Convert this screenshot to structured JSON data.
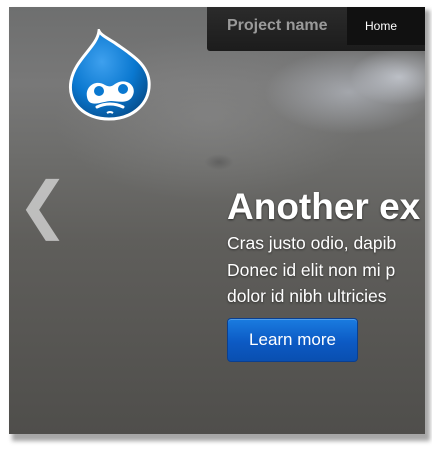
{
  "navbar": {
    "brand": "Project name",
    "items": [
      {
        "label": "Home",
        "active": true
      }
    ]
  },
  "carousel": {
    "prev_icon": "chevron-left-icon",
    "caption": {
      "title": "Another ex",
      "lines": [
        "Cras justo odio, dapib",
        "Donec id elit non mi p",
        "dolor id nibh ultricies"
      ],
      "button_label": "Learn more"
    }
  },
  "logo": {
    "icon": "drupal-drop-logo"
  },
  "colors": {
    "navbar_bg": "#222222",
    "nav_active_bg": "#111111",
    "button_blue": "#0c5ac4",
    "logo_blue": "#0a78d0"
  }
}
